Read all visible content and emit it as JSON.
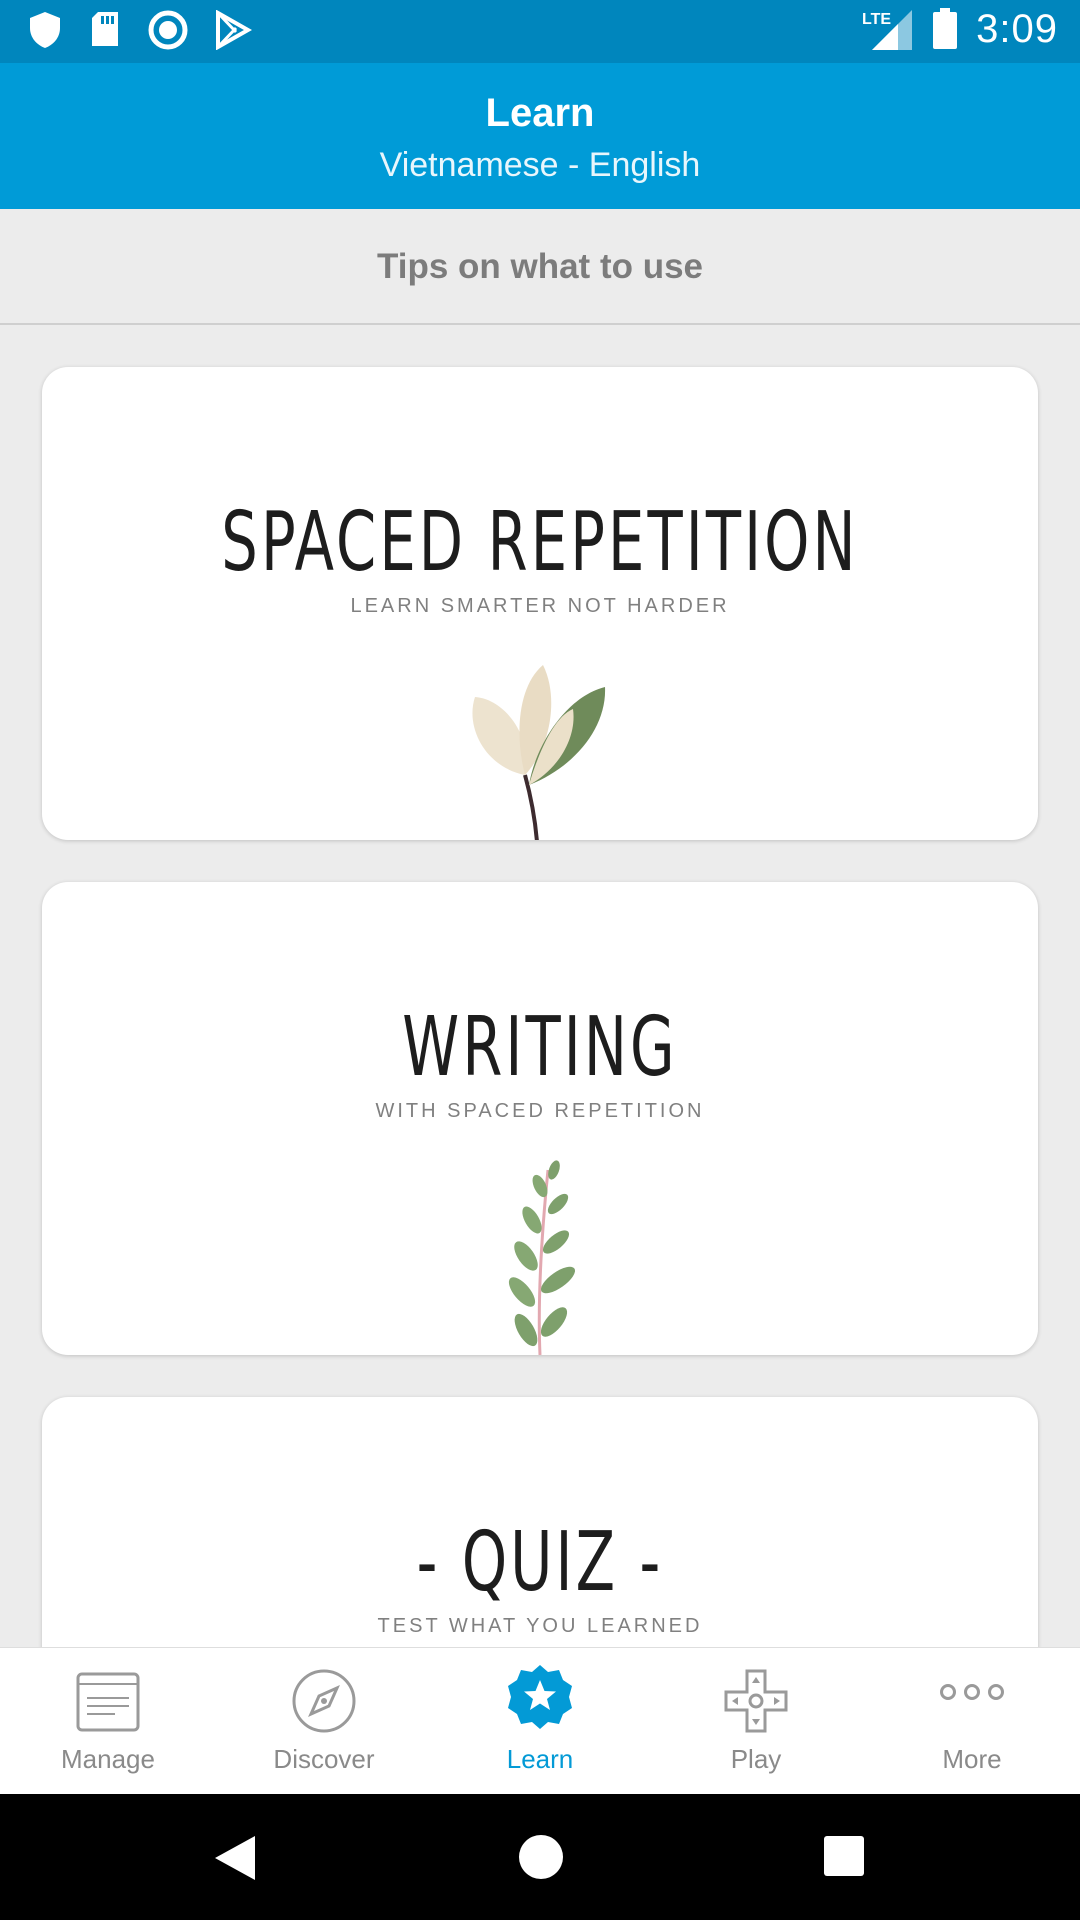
{
  "status_bar": {
    "time": "3:09",
    "network": "LTE",
    "left_icons": [
      "shield-icon",
      "sd-card-icon",
      "sync-circle-icon",
      "play-store-icon"
    ],
    "right_icons": [
      "lte-signal-icon",
      "battery-icon"
    ]
  },
  "header": {
    "title": "Learn",
    "subtitle": "Vietnamese - English",
    "color": "#009bd7"
  },
  "tips": {
    "label": "Tips on what to use"
  },
  "cards": [
    {
      "title": "SPACED REPETITION",
      "subtitle": "LEARN SMARTER NOT HARDER",
      "icon": "magnolia-branch-icon"
    },
    {
      "title": "WRITING",
      "subtitle": "WITH SPACED REPETITION",
      "icon": "eucalyptus-sprig-icon"
    },
    {
      "title": "- QUIZ -",
      "subtitle": "TEST WHAT YOU LEARNED",
      "icon": ""
    }
  ],
  "bottom_nav": {
    "active": "Learn",
    "active_color": "#039ad6",
    "items": [
      {
        "label": "Manage",
        "icon": "cards-icon"
      },
      {
        "label": "Discover",
        "icon": "compass-icon"
      },
      {
        "label": "Learn",
        "icon": "star-badge-icon"
      },
      {
        "label": "Play",
        "icon": "gamepad-icon"
      },
      {
        "label": "More",
        "icon": "more-dots-icon"
      }
    ]
  },
  "system_nav": [
    "back-icon",
    "home-icon",
    "recents-icon"
  ]
}
